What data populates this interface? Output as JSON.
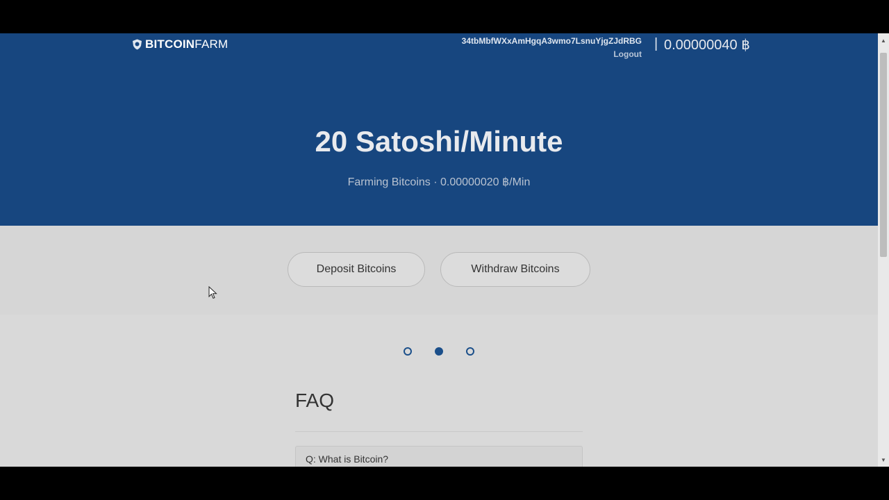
{
  "header": {
    "brand_bold": "BITCOIN",
    "brand_light": "FARM",
    "address": "34tbMbfWXxAmHgqA3wmo7LsnuYjgZJdRBG",
    "logout_label": "Logout",
    "separator": "|",
    "balance": "0.00000040 ฿"
  },
  "hero": {
    "title": "20 Satoshi/Minute",
    "subtitle": "Farming Bitcoins · 0.00000020 ฿/Min"
  },
  "actions": {
    "deposit_label": "Deposit Bitcoins",
    "withdraw_label": "Withdraw Bitcoins"
  },
  "carousel": {
    "active_index": 1,
    "count": 3
  },
  "faq": {
    "title": "FAQ",
    "items": [
      {
        "question": "Q: What is Bitcoin?"
      }
    ]
  },
  "icons": {
    "brand": "shield-icon",
    "scroll_up": "chevron-up-icon",
    "scroll_down": "chevron-down-icon",
    "cursor": "mouse-pointer-icon"
  },
  "colors": {
    "hero_bg": "#17467f",
    "page_bg": "#d9d9d9",
    "accent": "#1b4f8a"
  }
}
